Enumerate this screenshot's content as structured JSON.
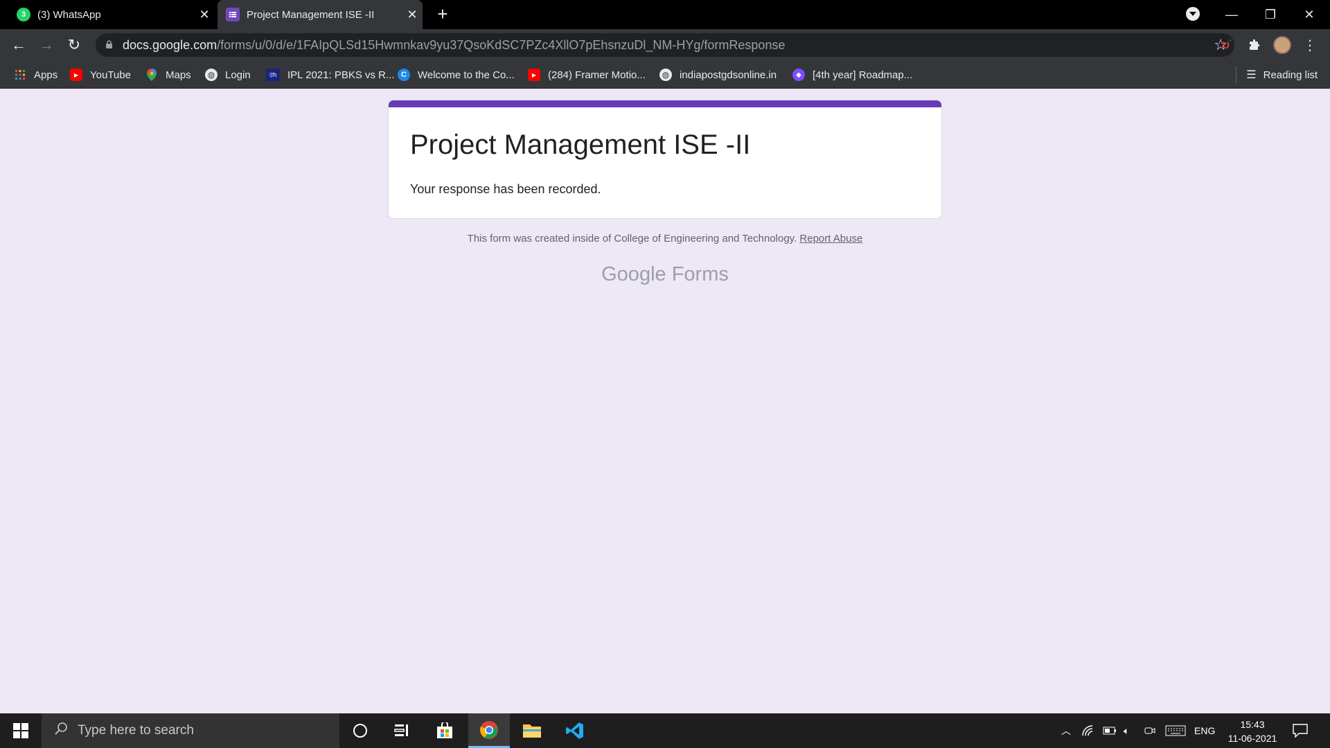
{
  "tabs": [
    {
      "title": "(3) WhatsApp",
      "icon": "whatsapp-icon",
      "badge": "3"
    },
    {
      "title": "Project Management ISE -II",
      "icon": "google-forms-icon"
    }
  ],
  "address": {
    "host": "docs.google.com",
    "path": "/forms/u/0/d/e/1FAIpQLSd15Hwmnkav9yu37QsoKdSC7PZc4XllO7pEhsnzuDl_NM-HYg/formResponse"
  },
  "bookmarks": [
    {
      "label": "Apps",
      "icon": "apps-grid-icon"
    },
    {
      "label": "YouTube",
      "icon": "youtube-icon"
    },
    {
      "label": "Maps",
      "icon": "maps-pin-icon"
    },
    {
      "label": "Login",
      "icon": "globe-icon"
    },
    {
      "label": "IPL 2021: PBKS vs R...",
      "icon": "site-icon",
      "icon_text": "ਰh"
    },
    {
      "label": "Welcome to the Co...",
      "icon": "c-logo-icon",
      "icon_text": "C"
    },
    {
      "label": "(284) Framer Motio...",
      "icon": "youtube-icon"
    },
    {
      "label": "indiapostgdsonline.in",
      "icon": "globe-icon"
    },
    {
      "label": "[4th year] Roadmap...",
      "icon": "diamond-icon"
    }
  ],
  "reading_list": "Reading list",
  "form": {
    "title": "Project Management ISE -II",
    "confirmation": "Your response has been recorded.",
    "footer_text": "This form was created inside of College of Engineering and Technology.",
    "report_abuse": "Report Abuse",
    "brand_google": "Google",
    "brand_forms": "Forms"
  },
  "taskbar": {
    "search_placeholder": "Type here to search",
    "language": "ENG",
    "time": "15:43",
    "date": "11-06-2021"
  },
  "colors": {
    "form_accent": "#673ab7",
    "page_background": "#ede7f6"
  }
}
